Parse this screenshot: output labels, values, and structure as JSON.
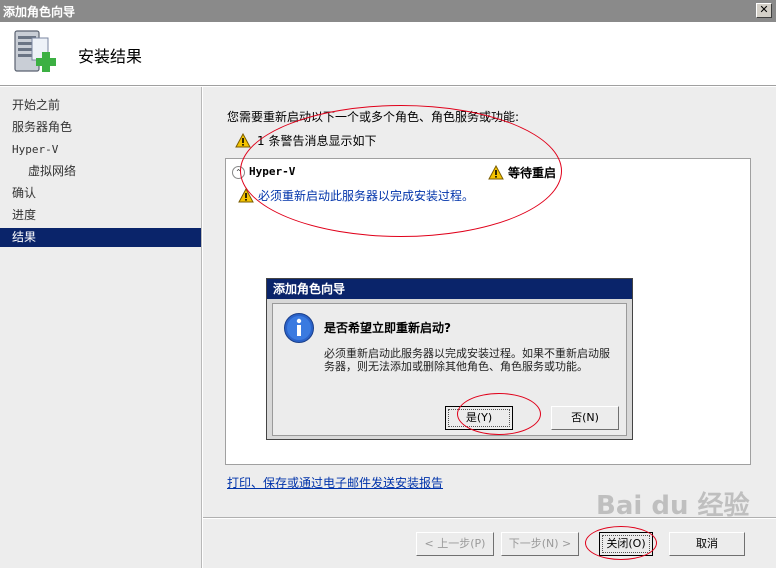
{
  "window": {
    "title": "添加角色向导",
    "close_glyph": "✕"
  },
  "header": {
    "title": "安装结果"
  },
  "sidebar": {
    "items": [
      {
        "label": "开始之前"
      },
      {
        "label": "服务器角色"
      },
      {
        "label": "Hyper-V"
      },
      {
        "label": "虚拟网络"
      },
      {
        "label": "确认"
      },
      {
        "label": "进度"
      },
      {
        "label": "结果"
      }
    ]
  },
  "main": {
    "intro": "您需要重新启动以下一个或多个角色、角色服务或功能:",
    "warning_summary": "1 条警告消息显示如下",
    "results": {
      "collapse_glyph": "⌃",
      "role_name": "Hyper-V",
      "status": "等待重启",
      "message": "必须重新启动此服务器以完成安装过程。"
    },
    "report_link": "打印、保存或通过电子邮件发送安装报告"
  },
  "dialog": {
    "title": "添加角色向导",
    "question": "是否希望立即重新启动?",
    "message": "必须重新启动此服务器以完成安装过程。如果不重新启动服务器，则无法添加或删除其他角色、角色服务或功能。",
    "yes_label": "是(Y)",
    "no_label": "否(N)"
  },
  "footer": {
    "prev_label": "< 上一步(P)",
    "next_label": "下一步(N) >",
    "close_label": "关闭(O)",
    "cancel_label": "取消"
  },
  "watermark": "Bai du 经验",
  "colors": {
    "selection": "#0a246a",
    "link": "#0033aa",
    "annotation": "#e0001a"
  }
}
